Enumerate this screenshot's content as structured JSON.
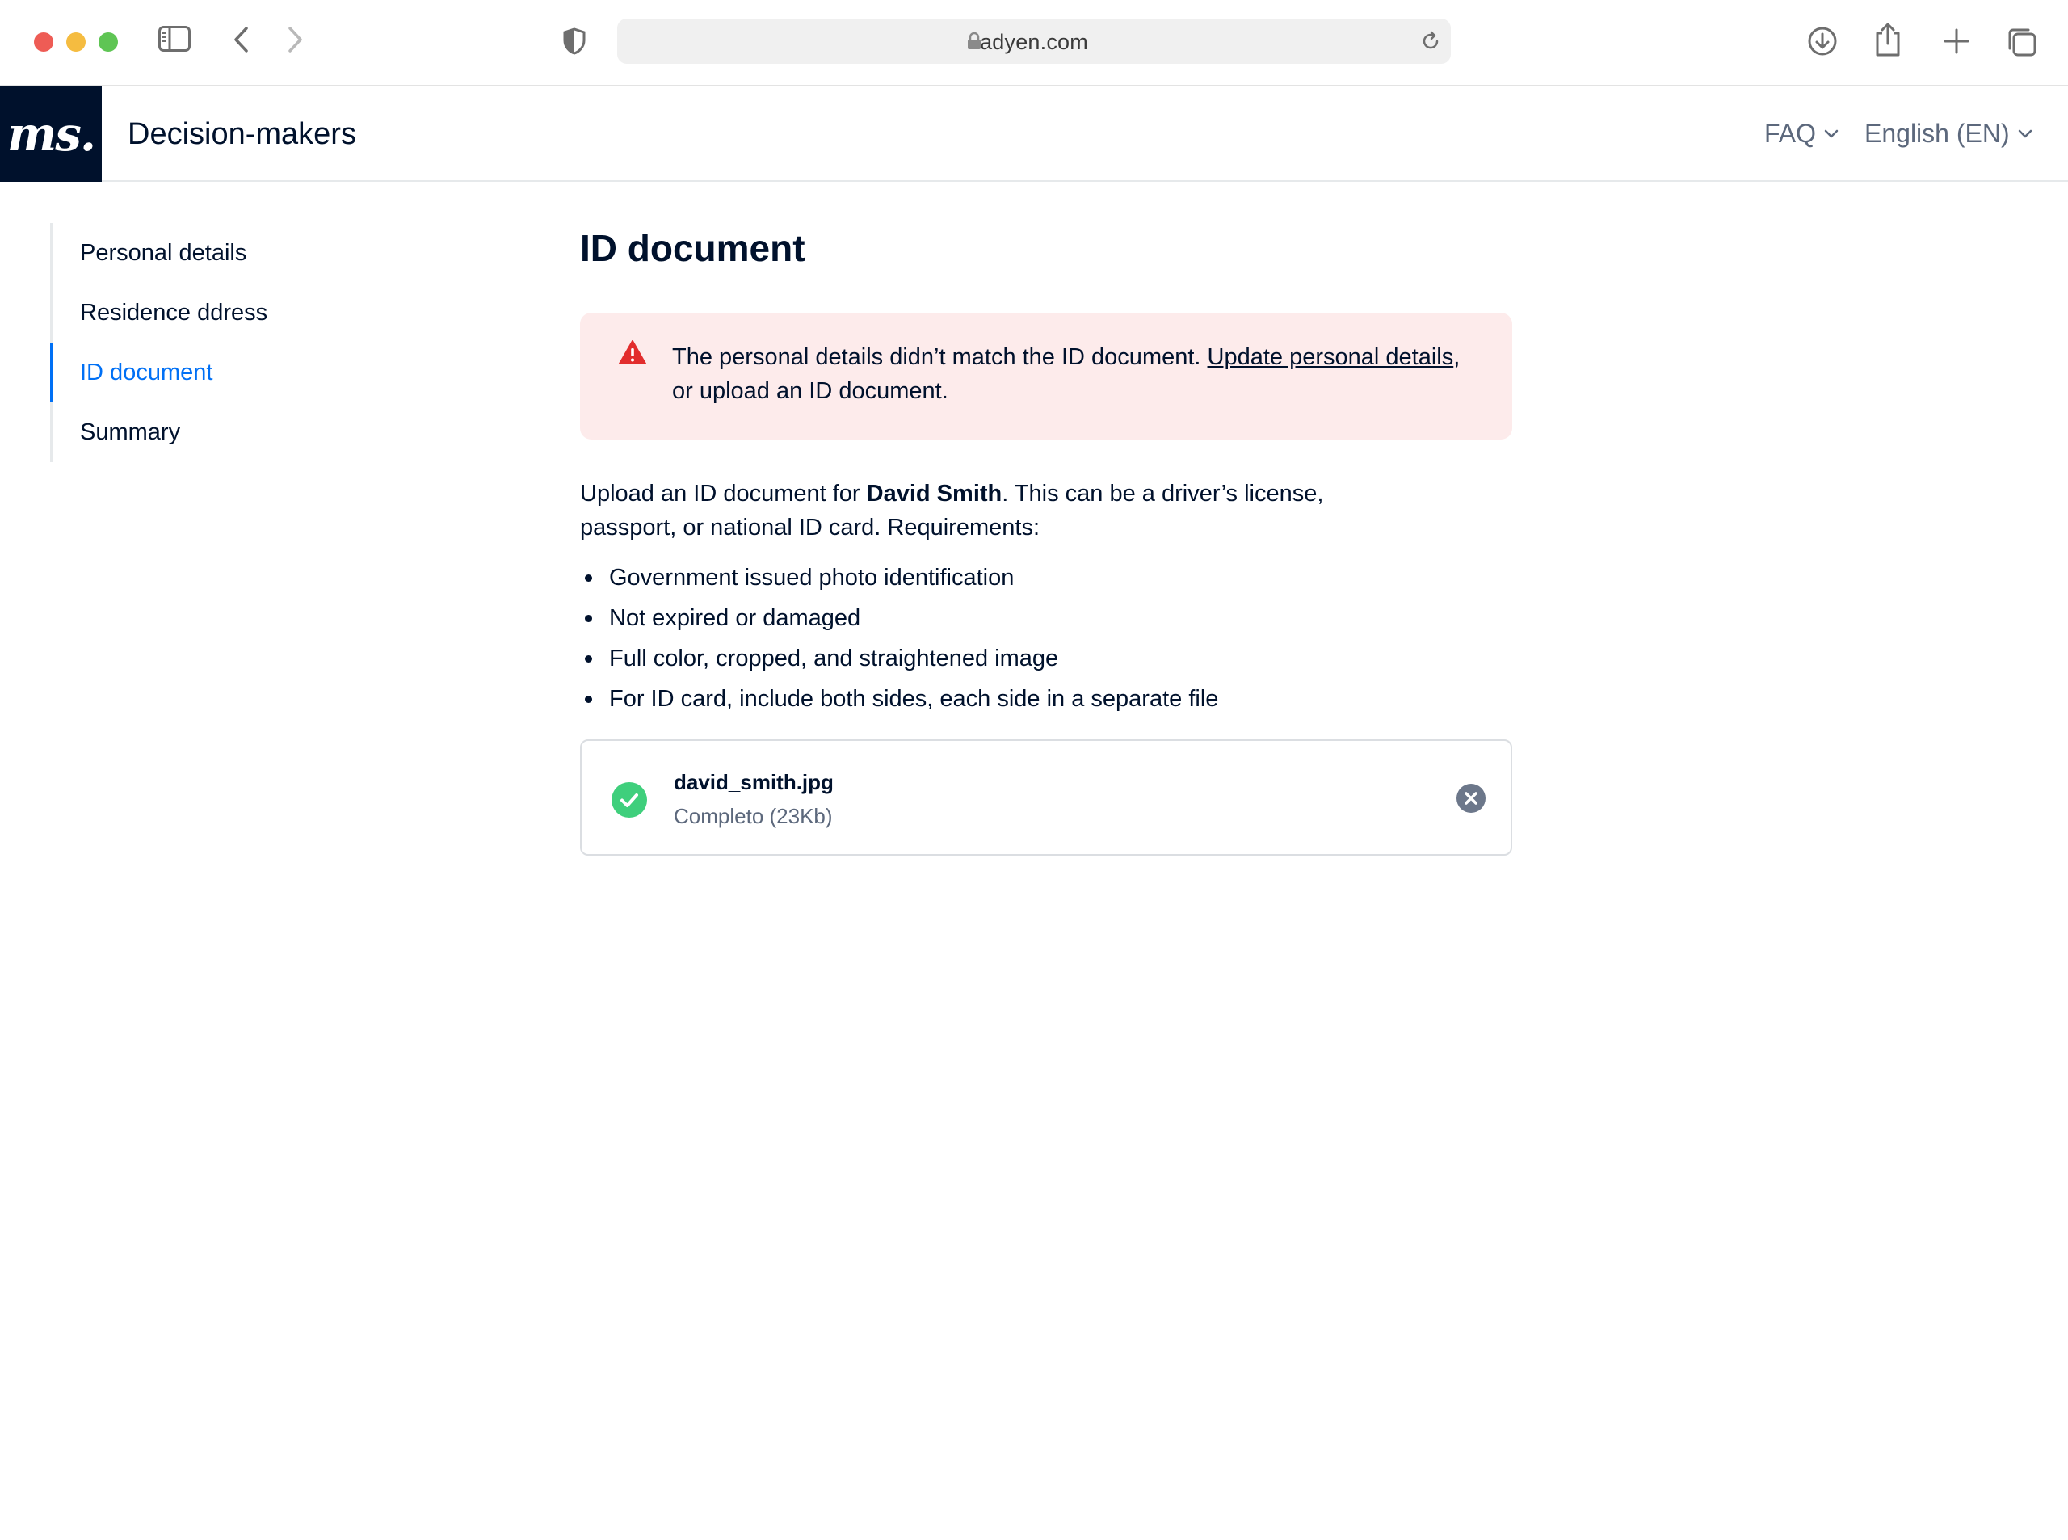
{
  "browser": {
    "url": "adyen.com",
    "icons": [
      "sidebar-toggle-icon",
      "back-icon",
      "forward-icon",
      "privacy-shield-icon",
      "lock-icon",
      "reload-icon",
      "download-icon",
      "share-icon",
      "new-tab-icon",
      "tab-overview-icon"
    ]
  },
  "header": {
    "logo_text": "ms.",
    "title": "Decision-makers",
    "faq_label": "FAQ",
    "language_label": "English (EN)"
  },
  "sidebar": {
    "items": [
      {
        "label": "Personal details",
        "active": false
      },
      {
        "label": "Residence ddress",
        "active": false
      },
      {
        "label": "ID document",
        "active": true
      },
      {
        "label": "Summary",
        "active": false
      }
    ]
  },
  "main": {
    "title": "ID document",
    "alert": {
      "text_before": "The personal details didn’t match the ID document. ",
      "link_text": "Update personal details",
      "text_after": ", or upload an ID document."
    },
    "intro": {
      "before": "Upload an ID document for ",
      "name": "David Smith",
      "after": ". This can be a driver’s license, passport, or national ID card. Requirements:"
    },
    "requirements": [
      "Government issued photo identification",
      "Not expired or damaged",
      "Full color, cropped, and straightened image",
      "For ID card, include both sides, each side in a separate file"
    ],
    "file": {
      "name": "david_smith.jpg",
      "status": "Completo (23Kb)"
    }
  },
  "colors": {
    "brand_dark": "#00112c",
    "accent_blue": "#0070f5",
    "error_bg": "#fdebeb",
    "error_icon": "#e22d2d",
    "success_green": "#3fcf7c",
    "muted_text": "#5c687c"
  }
}
